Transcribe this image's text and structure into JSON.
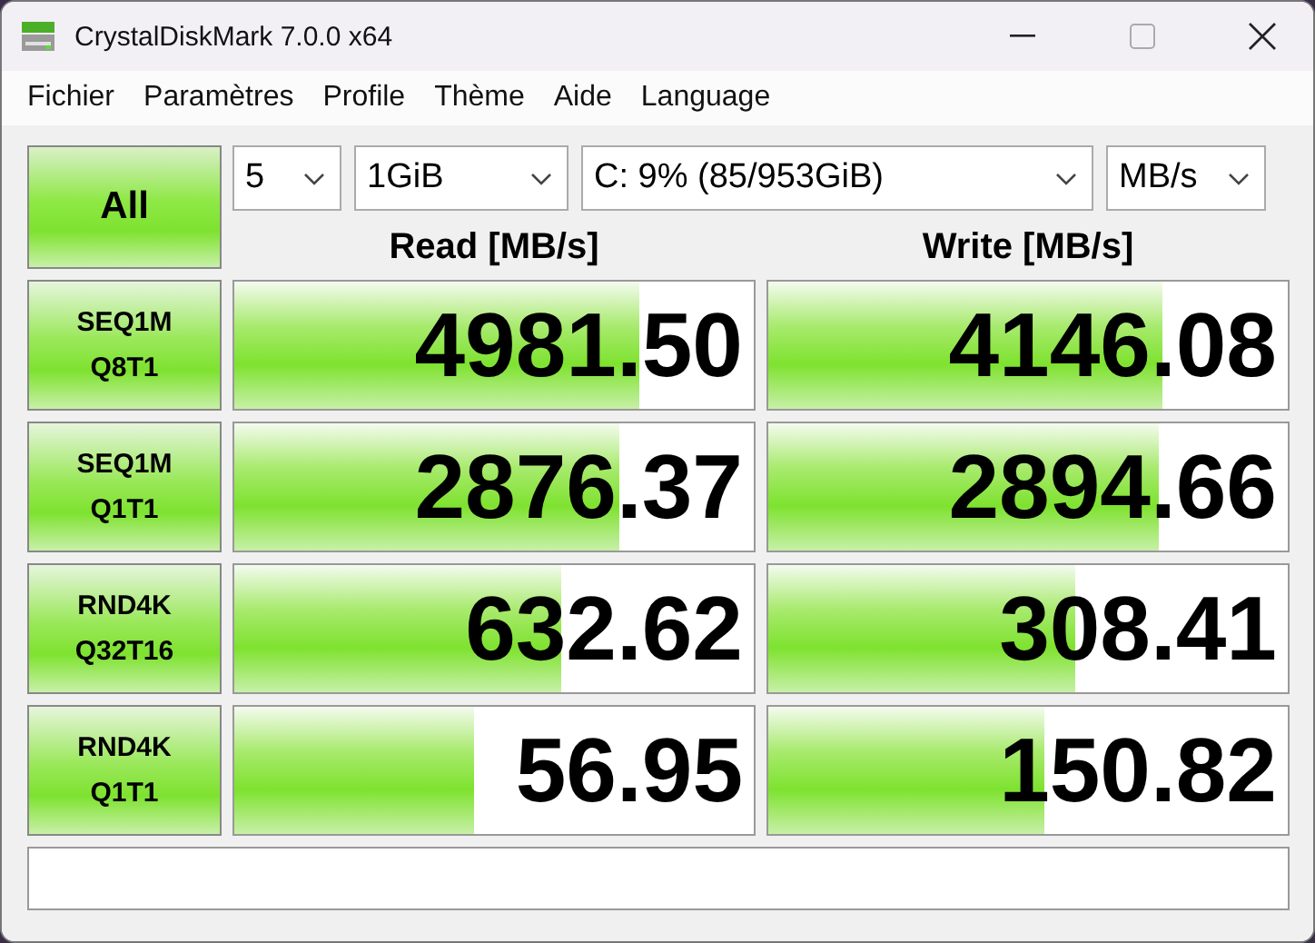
{
  "window": {
    "title": "CrystalDiskMark 7.0.0 x64"
  },
  "menu": [
    "Fichier",
    "Paramètres",
    "Profile",
    "Thème",
    "Aide",
    "Language"
  ],
  "all_button": "All",
  "selectors": [
    {
      "value": "5"
    },
    {
      "value": "1GiB"
    },
    {
      "value": "C: 9% (85/953GiB)"
    },
    {
      "value": "MB/s"
    }
  ],
  "headers": {
    "read": "Read [MB/s]",
    "write": "Write [MB/s]"
  },
  "tests": [
    {
      "line1": "SEQ1M",
      "line2": "Q8T1",
      "read": {
        "value": "4981.50",
        "level": 0.78
      },
      "write": {
        "value": "4146.08",
        "level": 0.76
      }
    },
    {
      "line1": "SEQ1M",
      "line2": "Q1T1",
      "read": {
        "value": "2876.37",
        "level": 0.74
      },
      "write": {
        "value": "2894.66",
        "level": 0.75
      }
    },
    {
      "line1": "RND4K",
      "line2": "Q32T16",
      "read": {
        "value": "632.62",
        "level": 0.63
      },
      "write": {
        "value": "308.41",
        "level": 0.59
      }
    },
    {
      "line1": "RND4K",
      "line2": "Q1T1",
      "read": {
        "value": "56.95",
        "level": 0.46
      },
      "write": {
        "value": "150.82",
        "level": 0.53
      }
    }
  ]
}
